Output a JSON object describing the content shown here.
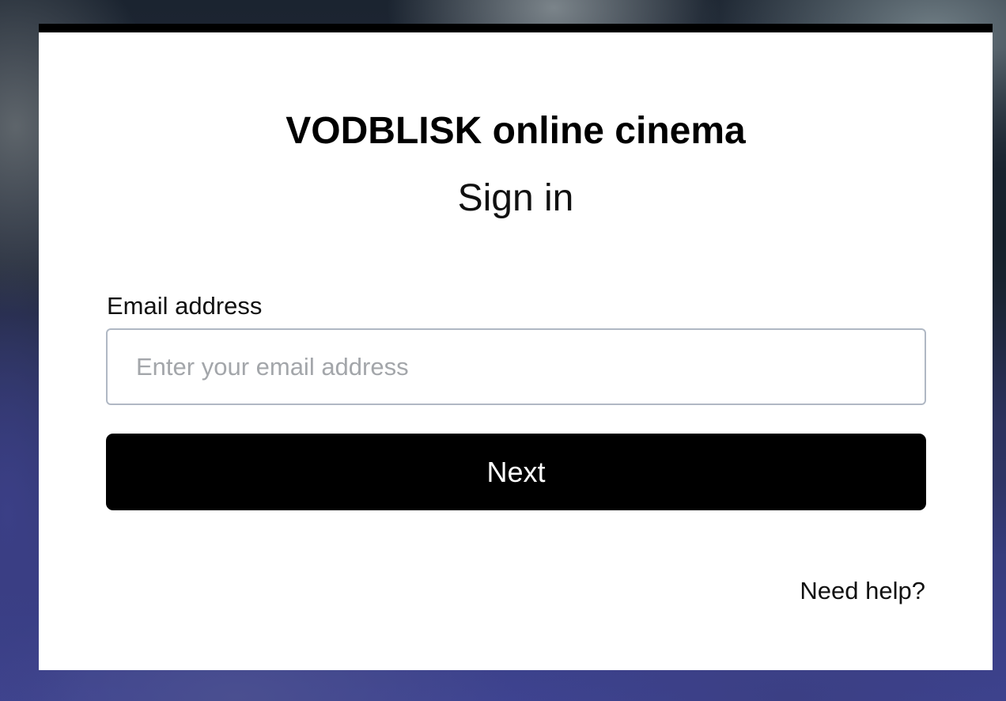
{
  "brand": {
    "title": "VODBLISK online cinema"
  },
  "heading": "Sign in",
  "email_field": {
    "label": "Email address",
    "value": "",
    "placeholder": "Enter your email address"
  },
  "primary_button": {
    "label": "Next"
  },
  "help_link": {
    "label": "Need help?"
  },
  "colors": {
    "card_background": "#ffffff",
    "card_top_border": "#000000",
    "button_background": "#000000",
    "button_text": "#ffffff",
    "input_border": "#b0b8c4",
    "placeholder_text": "#a3a6aa"
  }
}
